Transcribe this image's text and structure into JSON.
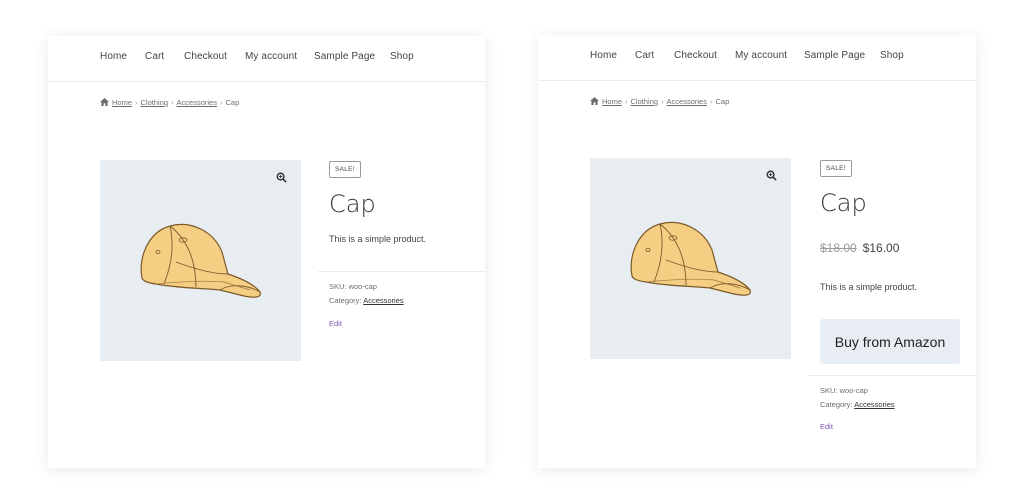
{
  "nav": {
    "items": [
      "Home",
      "Cart",
      "Checkout",
      "My account",
      "Sample Page",
      "Shop"
    ]
  },
  "breadcrumb": {
    "home": "Home",
    "sep": "›",
    "category": "Clothing",
    "subcategory": "Accessories",
    "current": "Cap"
  },
  "product": {
    "sale_badge": "SALE!",
    "title": "Cap",
    "description": "This is a simple product.",
    "regular_price": "$18.00",
    "sale_price": "$16.00",
    "sku_label": "SKU: woo-cap",
    "category_label": "Category:",
    "category_value": "Accessories",
    "edit_label": "Edit"
  },
  "buy_button": {
    "label": "Buy from Amazon"
  },
  "colors": {
    "gallery_bg": "#e8edf2",
    "button_bg": "#e8edf3",
    "edit_link": "#7f54b3",
    "cap_fill": "#f5cd83"
  },
  "icons": [
    "home-icon",
    "zoom-icon",
    "cap-image"
  ]
}
